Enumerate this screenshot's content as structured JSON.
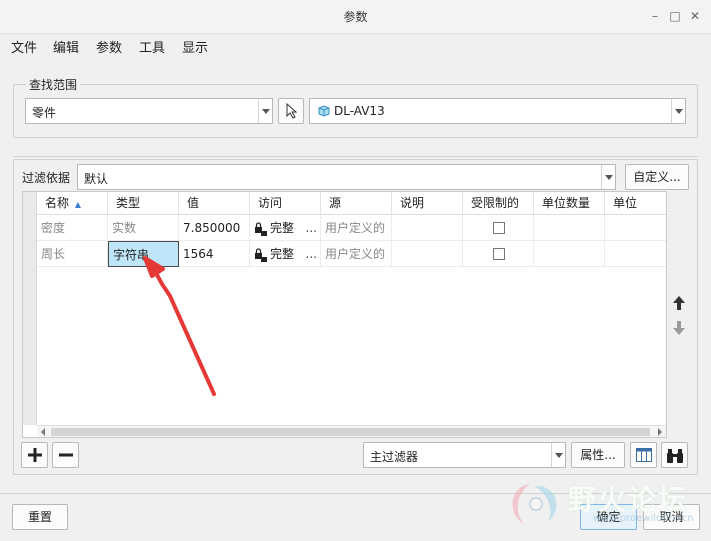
{
  "window": {
    "title": "参数",
    "controls": [
      "–",
      "□",
      "✕"
    ]
  },
  "menu": [
    "文件",
    "编辑",
    "参数",
    "工具",
    "显示"
  ],
  "scope": {
    "label": "查找范围",
    "type_value": "零件",
    "model_value": "DL-AV13"
  },
  "filter": {
    "label": "过滤依据",
    "value": "默认",
    "customize_label": "自定义..."
  },
  "table": {
    "columns": [
      "名称",
      "类型",
      "值",
      "访问",
      "源",
      "说明",
      "受限制的",
      "单位数量",
      "单位"
    ],
    "sort_indicator": "▲",
    "rows": [
      {
        "name": "密度",
        "type": "实数",
        "value": "7.850000",
        "access": "完整",
        "source": "用户定义的",
        "restricted": false
      },
      {
        "name": "周长",
        "type": "字符串",
        "value": "1564",
        "access": "完整",
        "source": "用户定义的",
        "restricted": false
      }
    ],
    "ellipsis": "..."
  },
  "bottom": {
    "main_filter": "主过滤器",
    "properties_label": "属性...",
    "add_icon": "plus-icon",
    "remove_icon": "minus-icon"
  },
  "footer": {
    "reset_label": "重置",
    "ok_label": "确定",
    "cancel_label": "取消"
  },
  "watermark": {
    "text": "野火论坛",
    "url": "www.proewildfire.cn"
  },
  "colors": {
    "selected_cell": "#bfe6f8",
    "annotation_arrow": "#e53935"
  }
}
